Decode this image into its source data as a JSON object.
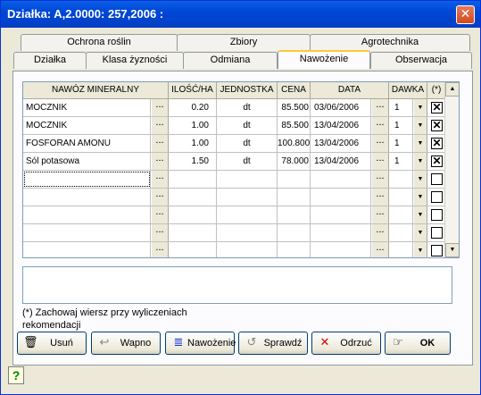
{
  "window": {
    "title": "Działka:  A,2.0000:  257,2006 :"
  },
  "tabs_back": [
    "Ochrona roślin",
    "Zbiory",
    "Agrotechnika"
  ],
  "tabs_front": [
    "Działka",
    "Klasa żyzności",
    "Odmiana",
    "Nawożenie",
    "Obserwacja"
  ],
  "active_tab": "Nawożenie",
  "grid": {
    "columns": [
      "NAWÓZ MINERALNY",
      "ILOŚĆ/HA",
      "JEDNOSTKA",
      "CENA",
      "DATA",
      "DAWKA",
      "(*)"
    ],
    "ellipsis": "...",
    "rows": [
      {
        "nawoz": "MOCZNIK",
        "ilosc": "0.20",
        "jednostka": "dt",
        "cena": "85.500",
        "data": "03/06/2006",
        "dawka": "1",
        "checked": true
      },
      {
        "nawoz": "MOCZNIK",
        "ilosc": "1.00",
        "jednostka": "dt",
        "cena": "85.500",
        "data": "13/04/2006",
        "dawka": "1",
        "checked": true
      },
      {
        "nawoz": "FOSFORAN AMONU",
        "ilosc": "1.00",
        "jednostka": "dt",
        "cena": "100.800",
        "data": "13/04/2006",
        "dawka": "1",
        "checked": true
      },
      {
        "nawoz": "Sól potasowa",
        "ilosc": "1.50",
        "jednostka": "dt",
        "cena": "78.000",
        "data": "13/04/2006",
        "dawka": "1",
        "checked": true
      }
    ],
    "empty_rows": 5
  },
  "note": "(*) Zachowaj wiersz przy wyliczeniach rekomendacji",
  "buttons": {
    "usun": "Usuń",
    "wapno": "Wapno",
    "nawozenie": "Nawożenie",
    "sprawdz": "Sprawdź",
    "odrzuc": "Odrzuć",
    "ok": "OK"
  },
  "icons": {
    "close": "close-icon",
    "help": "help-icon"
  },
  "colors": {
    "titlebar": "#0047d6",
    "active_tab_accent": "#ffc83c",
    "dialog_bg": "#ece9d8"
  }
}
